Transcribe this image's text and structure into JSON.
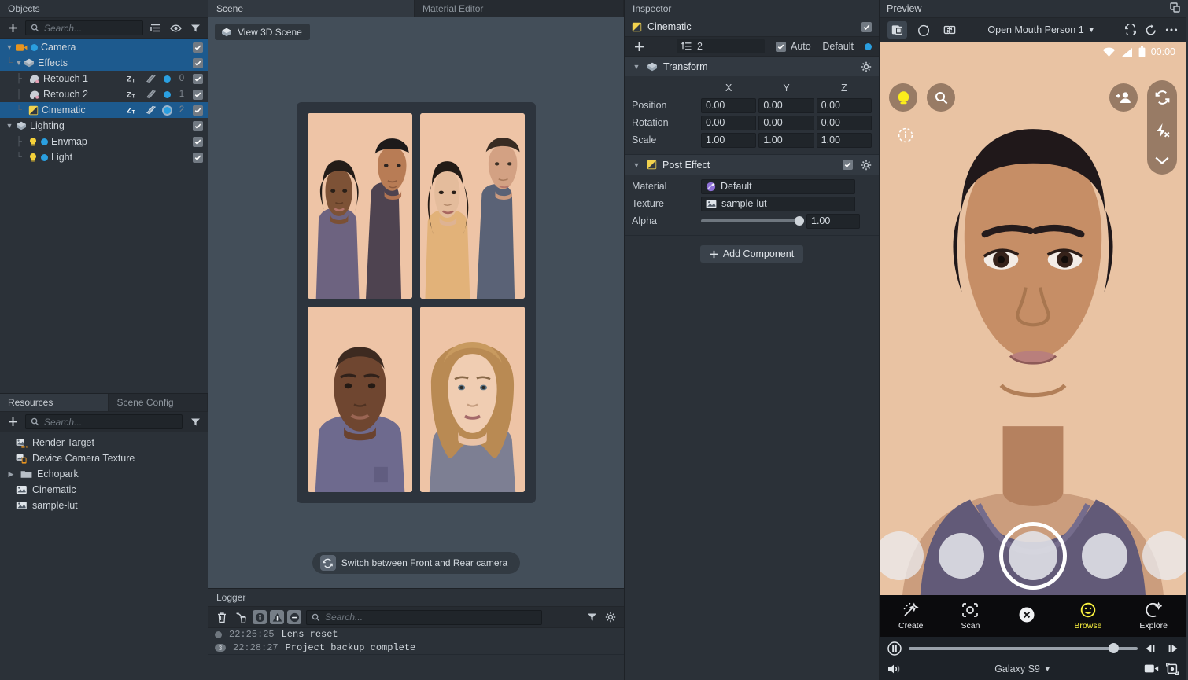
{
  "objects_panel": {
    "title": "Objects",
    "search_placeholder": "Search...",
    "icons": [
      "add-icon",
      "search-icon",
      "list-options-icon",
      "eye-icon",
      "filter-icon"
    ],
    "tree": [
      {
        "label": "Camera",
        "depth": 0,
        "type": "camera",
        "expanded": true,
        "selected": true,
        "enabled": true,
        "index": "",
        "has_badges": false
      },
      {
        "label": "Effects",
        "depth": 1,
        "type": "group",
        "expanded": true,
        "selected": true,
        "enabled": true,
        "index": "",
        "has_badges": false
      },
      {
        "label": "Retouch 1",
        "depth": 2,
        "type": "retouch",
        "expanded": false,
        "selected": false,
        "enabled": true,
        "index": "0",
        "has_badges": true
      },
      {
        "label": "Retouch 2",
        "depth": 2,
        "type": "retouch",
        "expanded": false,
        "selected": false,
        "enabled": true,
        "index": "1",
        "has_badges": true
      },
      {
        "label": "Cinematic",
        "depth": 2,
        "type": "posteffect",
        "expanded": false,
        "selected": true,
        "enabled": true,
        "index": "2",
        "has_badges": true
      },
      {
        "label": "Lighting",
        "depth": 0,
        "type": "group",
        "expanded": true,
        "selected": false,
        "enabled": true,
        "index": "",
        "has_badges": false
      },
      {
        "label": "Envmap",
        "depth": 1,
        "type": "light",
        "expanded": false,
        "selected": false,
        "enabled": true,
        "index": "",
        "has_badges": false
      },
      {
        "label": "Light",
        "depth": 1,
        "type": "light",
        "expanded": false,
        "selected": false,
        "enabled": true,
        "index": "",
        "has_badges": false
      }
    ]
  },
  "resources_panel": {
    "tabs": [
      {
        "label": "Resources",
        "active": true
      },
      {
        "label": "Scene Config",
        "active": false
      }
    ],
    "search_placeholder": "Search...",
    "items": [
      {
        "label": "Render Target",
        "icon": "render-target-icon",
        "folder": false
      },
      {
        "label": "Device Camera Texture",
        "icon": "device-camera-icon",
        "folder": false
      },
      {
        "label": "Echopark",
        "icon": "folder-icon",
        "folder": true
      },
      {
        "label": "Cinematic",
        "icon": "texture-icon",
        "folder": false
      },
      {
        "label": "sample-lut",
        "icon": "texture-icon",
        "folder": false
      }
    ]
  },
  "scene_panel": {
    "tabs": [
      {
        "label": "Scene",
        "active": true
      },
      {
        "label": "Material Editor",
        "active": false
      }
    ],
    "view_button": "View 3D Scene",
    "switch_camera_button": "Switch between Front and Rear camera",
    "photo_grid": [
      {
        "alt": "portrait-pair-1"
      },
      {
        "alt": "portrait-pair-2"
      },
      {
        "alt": "portrait-man-3"
      },
      {
        "alt": "portrait-woman-4"
      }
    ]
  },
  "logger_panel": {
    "title": "Logger",
    "search_placeholder": "Search...",
    "entries": [
      {
        "badge": "",
        "time": "22:25:25",
        "message": "Lens reset"
      },
      {
        "badge": "3",
        "time": "22:28:27",
        "message": "Project backup complete"
      }
    ]
  },
  "inspector": {
    "title": "Inspector",
    "object_name": "Cinematic",
    "enabled": true,
    "layer_count": "2",
    "auto_label": "Auto",
    "default_label": "Default",
    "accent": "#2a9fe0",
    "transform": {
      "title": "Transform",
      "axes": [
        "X",
        "Y",
        "Z"
      ],
      "rows": [
        {
          "label": "Position",
          "values": [
            "0.00",
            "0.00",
            "0.00"
          ]
        },
        {
          "label": "Rotation",
          "values": [
            "0.00",
            "0.00",
            "0.00"
          ]
        },
        {
          "label": "Scale",
          "values": [
            "1.00",
            "1.00",
            "1.00"
          ]
        }
      ]
    },
    "post_effect": {
      "title": "Post Effect",
      "enabled": true,
      "material_label": "Material",
      "material_value": "Default",
      "texture_label": "Texture",
      "texture_value": "sample-lut",
      "alpha_label": "Alpha",
      "alpha_value": "1.00",
      "alpha_percent": 100
    },
    "add_component_button": "Add Component"
  },
  "preview": {
    "title": "Preview",
    "lens_name": "Open Mouth Person 1",
    "status": {
      "time": "00:00"
    },
    "toolbar_icons": [
      "device-preview-icon",
      "reset-lens-icon",
      "sync-icon",
      "rotate-icon",
      "refresh-icon",
      "more-icon",
      "popout-icon"
    ],
    "overlay_icons": [
      "lens-icon",
      "search-icon",
      "add-friend-icon",
      "flip-camera-icon",
      "flash-off-icon",
      "chevron-down-icon",
      "info-icon"
    ],
    "nav": [
      {
        "label": "Create",
        "icon": "wand-icon",
        "active": false
      },
      {
        "label": "Scan",
        "icon": "scan-icon",
        "active": false
      },
      {
        "label": "",
        "icon": "close-icon",
        "active": false
      },
      {
        "label": "Browse",
        "icon": "smiley-icon",
        "active": true
      },
      {
        "label": "Explore",
        "icon": "compass-icon",
        "active": false
      }
    ],
    "device_name": "Galaxy S9",
    "playback": {
      "position_percent": 92,
      "paused": true
    }
  }
}
